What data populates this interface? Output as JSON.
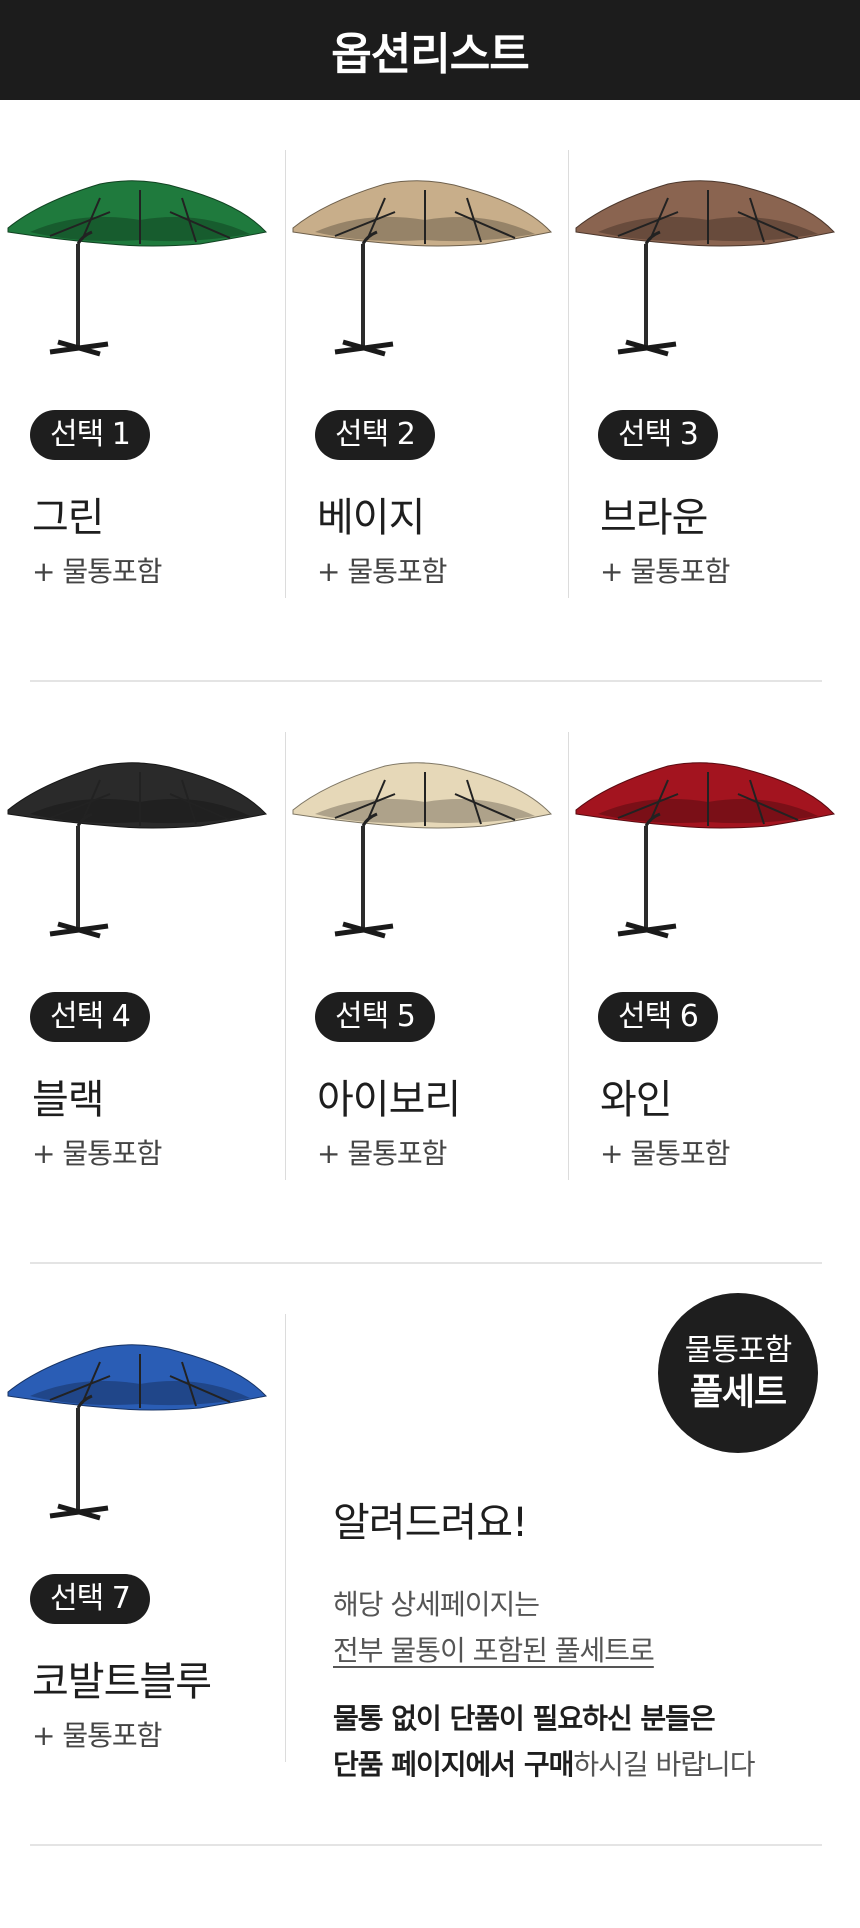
{
  "header": {
    "title": "옵션리스트"
  },
  "colors": {
    "header_bg": "#1c1c1c",
    "pill_bg": "#1e1e1e",
    "divider": "#e4e4e4"
  },
  "options": [
    {
      "tag": "선택 1",
      "name": "그린",
      "includes": "+ 물통포함",
      "color": "#1f7a3d"
    },
    {
      "tag": "선택 2",
      "name": "베이지",
      "includes": "+ 물통포함",
      "color": "#c8ae8a"
    },
    {
      "tag": "선택 3",
      "name": "브라운",
      "includes": "+ 물통포함",
      "color": "#8a6450"
    },
    {
      "tag": "선택 4",
      "name": "블랙",
      "includes": "+ 물통포함",
      "color": "#2a2a2a"
    },
    {
      "tag": "선택 5",
      "name": "아이보리",
      "includes": "+ 물통포함",
      "color": "#e6d8b8"
    },
    {
      "tag": "선택 6",
      "name": "와인",
      "includes": "+ 물통포함",
      "color": "#a3141f"
    },
    {
      "tag": "선택 7",
      "name": "코발트블루",
      "includes": "+ 물통포함",
      "color": "#2a5db5"
    }
  ],
  "badge": {
    "line1": "물통포함",
    "line2": "풀세트"
  },
  "notice": {
    "title": "알려드려요!",
    "line1": "해당 상세페이지는",
    "line2": "전부 물통이 포함된 풀세트로",
    "line3": "물통 없이 단품이 필요하신 분들은",
    "line4_bold": "단품 페이지에서 구매",
    "line4_rest": "하시길 바랍니다"
  }
}
